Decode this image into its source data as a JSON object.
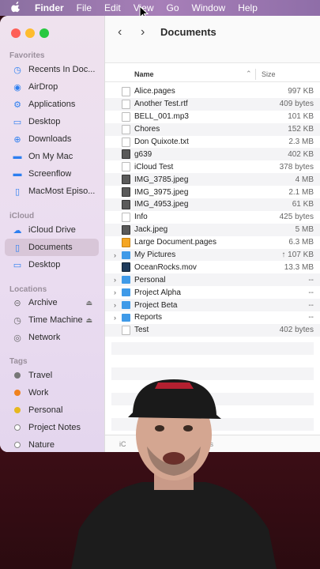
{
  "menubar": {
    "app": "Finder",
    "items": [
      "File",
      "Edit",
      "View",
      "Go",
      "Window",
      "Help"
    ]
  },
  "window": {
    "title": "Documents",
    "back_glyph": "‹",
    "forward_glyph": "›"
  },
  "sidebar": {
    "favorites_header": "Favorites",
    "favorites": [
      {
        "label": "Recents In Doc...",
        "icon": "clock-icon"
      },
      {
        "label": "AirDrop",
        "icon": "airdrop-icon"
      },
      {
        "label": "Applications",
        "icon": "applications-icon"
      },
      {
        "label": "Desktop",
        "icon": "desktop-icon"
      },
      {
        "label": "Downloads",
        "icon": "downloads-icon"
      },
      {
        "label": "On My Mac",
        "icon": "folder-icon"
      },
      {
        "label": "Screenflow",
        "icon": "folder-icon"
      },
      {
        "label": "MacMost Episo...",
        "icon": "document-icon"
      }
    ],
    "icloud_header": "iCloud",
    "icloud": [
      {
        "label": "iCloud Drive",
        "icon": "cloud-icon"
      },
      {
        "label": "Documents",
        "icon": "document-icon",
        "selected": true
      },
      {
        "label": "Desktop",
        "icon": "desktop-icon"
      }
    ],
    "locations_header": "Locations",
    "locations": [
      {
        "label": "Archive",
        "icon": "drive-icon",
        "eject": true
      },
      {
        "label": "Time Machine",
        "icon": "time-machine-icon",
        "eject": true
      },
      {
        "label": "Network",
        "icon": "network-icon"
      }
    ],
    "tags_header": "Tags",
    "tags": [
      {
        "label": "Travel",
        "color": "#777777"
      },
      {
        "label": "Work",
        "color": "#f0821e"
      },
      {
        "label": "Personal",
        "color": "#e6b81e"
      },
      {
        "label": "Project Notes",
        "color": "#ffffff"
      },
      {
        "label": "Nature",
        "color": "#ffffff"
      }
    ]
  },
  "columns": {
    "name": "Name",
    "size": "Size"
  },
  "files": [
    {
      "name": "Alice.pages",
      "size": "997 KB",
      "kind": "doc"
    },
    {
      "name": "Another Test.rtf",
      "size": "409 bytes",
      "kind": "doc"
    },
    {
      "name": "BELL_001.mp3",
      "size": "101 KB",
      "kind": "doc"
    },
    {
      "name": "Chores",
      "size": "152 KB",
      "kind": "doc"
    },
    {
      "name": "Don Quixote.txt",
      "size": "2.3 MB",
      "kind": "doc"
    },
    {
      "name": "g639",
      "size": "402 KB",
      "kind": "img"
    },
    {
      "name": "iCloud Test",
      "size": "378 bytes",
      "kind": "doc"
    },
    {
      "name": "IMG_3785.jpeg",
      "size": "4 MB",
      "kind": "img"
    },
    {
      "name": "IMG_3975.jpeg",
      "size": "2.1 MB",
      "kind": "img"
    },
    {
      "name": "IMG_4953.jpeg",
      "size": "61 KB",
      "kind": "img"
    },
    {
      "name": "Info",
      "size": "425 bytes",
      "kind": "doc"
    },
    {
      "name": "Jack.jpeg",
      "size": "5 MB",
      "kind": "img"
    },
    {
      "name": "Large Document.pages",
      "size": "6.3 MB",
      "kind": "pages"
    },
    {
      "name": "My Pictures",
      "size": "↑ 107 KB",
      "kind": "folder",
      "disclosure": true
    },
    {
      "name": "OceanRocks.mov",
      "size": "13.3 MB",
      "kind": "mov"
    },
    {
      "name": "Personal",
      "size": "--",
      "kind": "folder",
      "disclosure": true
    },
    {
      "name": "Project Alpha",
      "size": "--",
      "kind": "folder",
      "disclosure": true
    },
    {
      "name": "Project Beta",
      "size": "--",
      "kind": "folder",
      "disclosure": true
    },
    {
      "name": "Reports",
      "size": "--",
      "kind": "folder",
      "disclosure": true
    },
    {
      "name": "Test",
      "size": "402 bytes",
      "kind": "doc"
    }
  ],
  "statusbar": {
    "left": "iC",
    "right": "ents"
  },
  "colors": {
    "accent": "#2d7ff0",
    "selected": "#d8c6d8",
    "folder": "#3f9ae8"
  }
}
